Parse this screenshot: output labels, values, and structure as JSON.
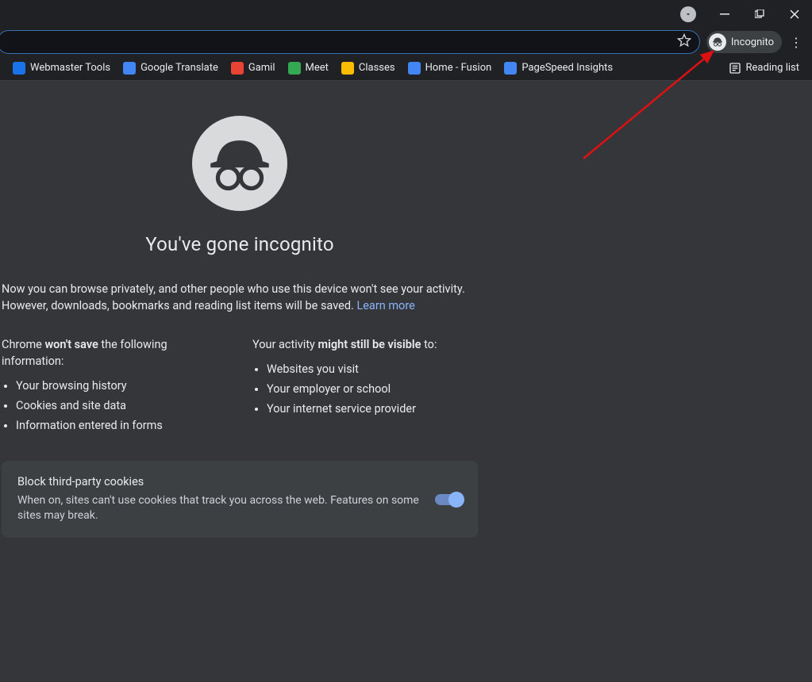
{
  "window": {
    "incognito_label": "Incognito"
  },
  "bookmarks": [
    {
      "label": "Webmaster Tools",
      "color": "#1a73e8"
    },
    {
      "label": "Google Translate",
      "color": "#4285f4"
    },
    {
      "label": "Gamil",
      "color": "#ea4335"
    },
    {
      "label": "Meet",
      "color": "#34a853"
    },
    {
      "label": "Classes",
      "color": "#fbbc04"
    },
    {
      "label": "Home - Fusion",
      "color": "#4285f4"
    },
    {
      "label": "PageSpeed Insights",
      "color": "#4285f4"
    }
  ],
  "reading_list_label": "Reading list",
  "page": {
    "title": "You've gone incognito",
    "intro_line1": "Now you can browse privately, and other people who use this device won't see your activity.",
    "intro_line2_prefix": "However, downloads, bookmarks and reading list items will be saved. ",
    "learn_more": "Learn more",
    "col1_title_a": "Chrome ",
    "col1_title_b": "won't save",
    "col1_title_c": " the following information:",
    "col1_items": [
      "Your browsing history",
      "Cookies and site data",
      "Information entered in forms"
    ],
    "col2_title_a": "Your activity ",
    "col2_title_b": "might still be visible",
    "col2_title_c": " to:",
    "col2_items": [
      "Websites you visit",
      "Your employer or school",
      "Your internet service provider"
    ],
    "cookie_title": "Block third-party cookies",
    "cookie_desc": "When on, sites can't use cookies that track you across the web. Features on some sites may break."
  }
}
